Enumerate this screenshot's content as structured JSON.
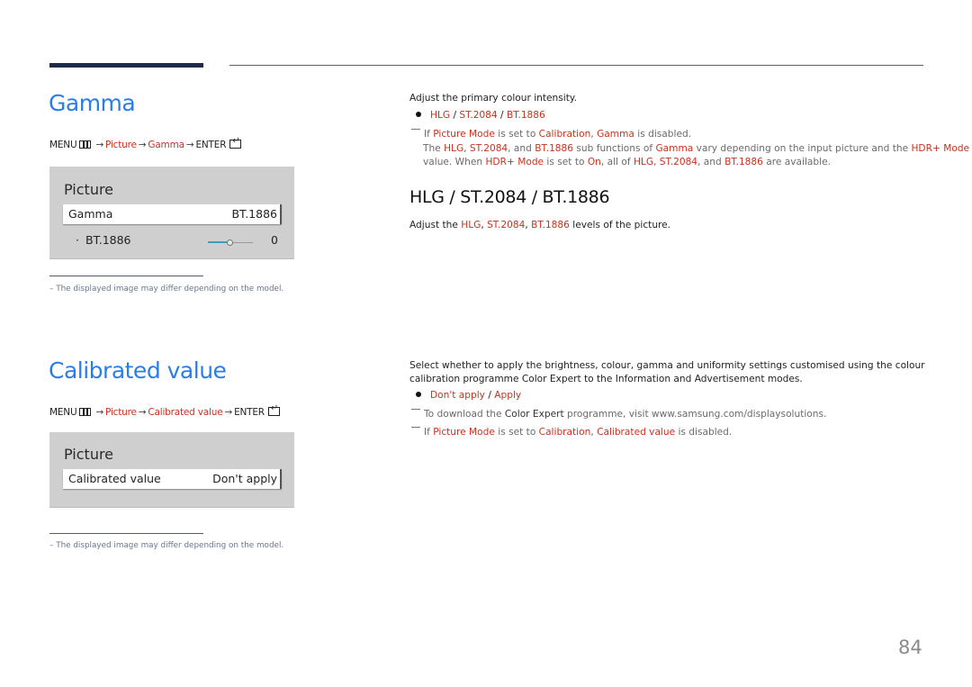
{
  "page_number": "84",
  "colors": {
    "title_blue": "#2a7de9",
    "highlight_red": "#c8321e",
    "osd_grey": "#cfcfcf",
    "slider_blue": "#3a9dc4"
  },
  "gamma": {
    "title": "Gamma",
    "menu_path": {
      "menu": "MENU",
      "menu_icon": "menu-icon",
      "arrow": "→",
      "step1": "Picture",
      "step2": "Gamma",
      "enter": "ENTER",
      "enter_icon": "enter-icon"
    },
    "osd": {
      "title": "Picture",
      "selected_row": {
        "label": "Gamma",
        "value": "BT.1886"
      },
      "sub_row": {
        "bullet": "·",
        "label": "BT.1886",
        "slider_fraction": 0.5,
        "value": "0"
      }
    },
    "footnote": "–  The displayed image may differ depending on the model.",
    "description": "Adjust the primary colour intensity.",
    "options": {
      "a": "HLG",
      "sep": " / ",
      "b": "ST.2084",
      "c": "BT.1886"
    },
    "note1": {
      "p1": "If ",
      "picture_mode": "Picture Mode",
      "p2": " is set to ",
      "calibration": "Calibration",
      "comma": ", ",
      "gamma": "Gamma",
      "p3": " is disabled."
    },
    "note2": {
      "line1": {
        "p1": "The ",
        "hlg": "HLG",
        "c1": ", ",
        "st": "ST.2084",
        "c2": ", and ",
        "bt": "BT.1886",
        "p2": " sub functions of ",
        "gamma": "Gamma",
        "p3": " vary depending on the input picture and the ",
        "hdr": "HDR+ Mode"
      },
      "line2": {
        "p1": "value. When ",
        "hdr": "HDR+ Mode",
        "p2": " is set to ",
        "on": "On",
        "p3": ", all of ",
        "hlg": "HLG",
        "c1": ", ",
        "st": "ST.2084",
        "c2": ", and ",
        "bt": "BT.1886",
        "p4": " are available."
      }
    },
    "sub_section": {
      "heading": "HLG / ST.2084 / BT.1886",
      "text": {
        "p1": "Adjust the ",
        "hlg": "HLG",
        "c1": ", ",
        "st": "ST.2084",
        "c2": ", ",
        "bt": "BT.1886",
        "p2": " levels of the picture."
      }
    }
  },
  "calibrated": {
    "title": "Calibrated value",
    "menu_path": {
      "menu": "MENU",
      "arrow": "→",
      "step1": "Picture",
      "step2": "Calibrated value",
      "enter": "ENTER"
    },
    "osd": {
      "title": "Picture",
      "selected_row": {
        "label": "Calibrated value",
        "value": "Don't apply"
      }
    },
    "footnote": "–  The displayed image may differ depending on the model.",
    "description_line1": "Select whether to apply the brightness, colour, gamma and uniformity settings customised using the colour",
    "description_line2": {
      "p1": "calibration programme ",
      "ce": "Color Expert",
      "p2": " to the Information and Advertisement modes."
    },
    "options": {
      "a": "Don't apply",
      "sep": " / ",
      "b": "Apply"
    },
    "note1": {
      "p1": "To download the ",
      "ce": "Color Expert",
      "p2": " programme, visit www.samsung.com/displaysolutions."
    },
    "note2": {
      "p1": "If ",
      "picture_mode": "Picture Mode",
      "p2": " is set to ",
      "calibration": "Calibration",
      "comma": ", ",
      "cv": "Calibrated value",
      "p3": " is disabled."
    }
  }
}
